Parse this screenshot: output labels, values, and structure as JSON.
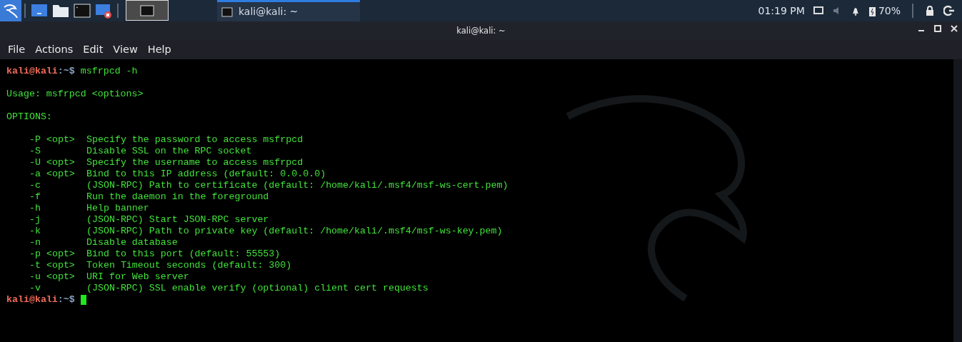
{
  "taskbar": {
    "workspaces": [
      {
        "selected": true
      }
    ],
    "tasks": [
      {
        "title": "kali@kali: ~",
        "active": true
      }
    ],
    "clock": "01:19 PM",
    "battery": "70%"
  },
  "window": {
    "title": "kali@kali: ~"
  },
  "menu": [
    "File",
    "Actions",
    "Edit",
    "View",
    "Help"
  ],
  "terminal": {
    "lines": [
      {
        "kind": "prompt",
        "user": "kali@kali",
        "path": ":~$",
        "command": "msfrpcd -h"
      },
      {
        "kind": "blank"
      },
      {
        "kind": "output",
        "text": "Usage: msfrpcd <options>"
      },
      {
        "kind": "blank"
      },
      {
        "kind": "output",
        "text": "OPTIONS:"
      },
      {
        "kind": "blank"
      },
      {
        "kind": "option",
        "flag": "-P <opt>",
        "description": "Specify the password to access msfrpcd"
      },
      {
        "kind": "option",
        "flag": "-S",
        "description": "Disable SSL on the RPC socket"
      },
      {
        "kind": "option",
        "flag": "-U <opt>",
        "description": "Specify the username to access msfrpcd"
      },
      {
        "kind": "option",
        "flag": "-a <opt>",
        "description": "Bind to this IP address (default: 0.0.0.0)"
      },
      {
        "kind": "option",
        "flag": "-c",
        "description": "(JSON-RPC) Path to certificate (default: /home/kali/.msf4/msf-ws-cert.pem)"
      },
      {
        "kind": "option",
        "flag": "-f",
        "description": "Run the daemon in the foreground"
      },
      {
        "kind": "option",
        "flag": "-h",
        "description": "Help banner"
      },
      {
        "kind": "option",
        "flag": "-j",
        "description": "(JSON-RPC) Start JSON-RPC server"
      },
      {
        "kind": "option",
        "flag": "-k",
        "description": "(JSON-RPC) Path to private key (default: /home/kali/.msf4/msf-ws-key.pem)"
      },
      {
        "kind": "option",
        "flag": "-n",
        "description": "Disable database"
      },
      {
        "kind": "option",
        "flag": "-p <opt>",
        "description": "Bind to this port (default: 55553)"
      },
      {
        "kind": "option",
        "flag": "-t <opt>",
        "description": "Token Timeout seconds (default: 300)"
      },
      {
        "kind": "option",
        "flag": "-u <opt>",
        "description": "URI for Web server"
      },
      {
        "kind": "option",
        "flag": "-v",
        "description": "(JSON-RPC) SSL enable verify (optional) client cert requests"
      },
      {
        "kind": "prompt",
        "user": "kali@kali",
        "path": ":~$",
        "cursor": true
      }
    ]
  }
}
